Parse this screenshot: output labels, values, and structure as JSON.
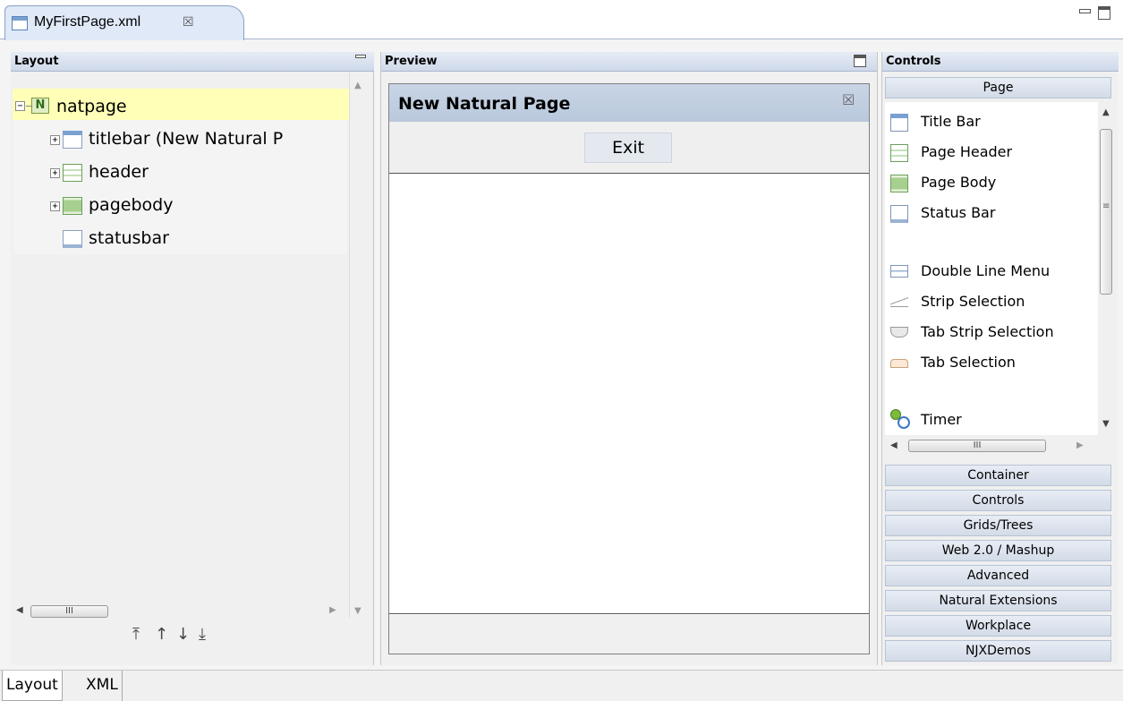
{
  "editor": {
    "tab_label": "MyFirstPage.xml",
    "close_glyph": "☒"
  },
  "layout_panel": {
    "title": "Layout",
    "tree": [
      {
        "label": "natpage",
        "expander": "−",
        "icon": "natural-page-icon",
        "selected": true
      },
      {
        "label": "titlebar (New Natural P",
        "expander": "+",
        "icon": "titlebar-icon"
      },
      {
        "label": "header",
        "expander": "+",
        "icon": "header-icon"
      },
      {
        "label": "pagebody",
        "expander": "+",
        "icon": "pagebody-icon"
      },
      {
        "label": "statusbar",
        "expander": "",
        "icon": "statusbar-icon"
      }
    ],
    "hscroll_grip": "III",
    "move_buttons": [
      "⤒",
      "↑",
      "↓",
      "⤓"
    ]
  },
  "preview_panel": {
    "title": "Preview",
    "page_title": "New Natural Page",
    "exit_label": "Exit"
  },
  "controls_panel": {
    "title": "Controls",
    "active_category": "Page",
    "items": [
      {
        "label": "Title Bar",
        "icon": "titlebar-icon"
      },
      {
        "label": "Page Header",
        "icon": "page-header-icon"
      },
      {
        "label": "Page Body",
        "icon": "page-body-icon"
      },
      {
        "label": "Status Bar",
        "icon": "status-bar-icon"
      },
      {
        "label": "Double Line Menu",
        "icon": "double-line-menu-icon"
      },
      {
        "label": "Strip Selection",
        "icon": "strip-selection-icon"
      },
      {
        "label": "Tab Strip Selection",
        "icon": "tab-strip-selection-icon"
      },
      {
        "label": "Tab Selection",
        "icon": "tab-selection-icon"
      },
      {
        "label": "Timer",
        "icon": "timer-icon"
      }
    ],
    "hscroll_grip": "III",
    "categories": [
      "Container",
      "Controls",
      "Grids/Trees",
      "Web 2.0 / Mashup",
      "Advanced",
      "Natural Extensions",
      "Workplace",
      "NJXDemos"
    ]
  },
  "bottom_tabs": [
    "Layout",
    "XML"
  ],
  "colors": {
    "selection": "#ffffb7",
    "panel_header": "#cfd9ea",
    "title_bar": "#b9c8dc"
  }
}
